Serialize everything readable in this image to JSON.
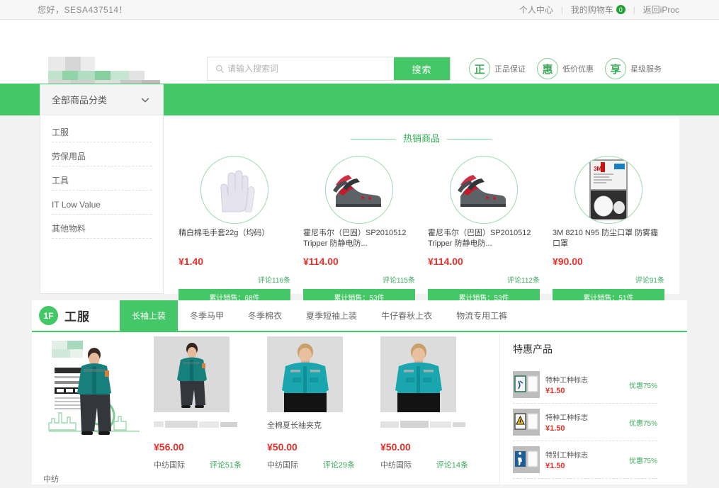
{
  "topbar": {
    "greeting": "您好，SESA437514！",
    "links": [
      {
        "label": "个人中心"
      },
      {
        "label": "我的购物车",
        "badge": "0"
      },
      {
        "label": "返回iProc"
      }
    ],
    "separator": "|"
  },
  "header": {
    "search": {
      "placeholder": "请输入搜索词",
      "value": "",
      "button_label": "搜索",
      "icon": "search-icon"
    },
    "badges": [
      {
        "glyph": "正",
        "label": "正品保证"
      },
      {
        "glyph": "惠",
        "label": "低价优惠"
      },
      {
        "glyph": "享",
        "label": "星级服务"
      }
    ]
  },
  "category_panel": {
    "title": "全部商品分类",
    "chevron_icon": "chevron-down-icon",
    "items": [
      {
        "label": "工服"
      },
      {
        "label": "劳保用品"
      },
      {
        "label": "工具"
      },
      {
        "label": "IT Low Value"
      },
      {
        "label": "其他物料"
      }
    ]
  },
  "hot_section": {
    "title": "热销商品",
    "products": [
      {
        "name": "精白棉毛手套22g（均码）",
        "price": "¥1.40",
        "comments": "评论116条",
        "sales": "累计销售：68件",
        "image": "white-cotton-gloves"
      },
      {
        "name": "霍尼韦尔（巴固）SP2010512 Tripper 防静电防...",
        "price": "¥114.00",
        "comments": "评论115条",
        "sales": "累计销售：53件",
        "image": "safety-shoes"
      },
      {
        "name": "霍尼韦尔（巴固）SP2010512 Tripper 防静电防...",
        "price": "¥114.00",
        "comments": "评论112条",
        "sales": "累计销售：53件",
        "image": "safety-shoes"
      },
      {
        "name": "3M 8210 N95 防尘口罩 防雾霾口罩",
        "price": "¥90.00",
        "comments": "评论91条",
        "sales": "累计销售：51件",
        "image": "n95-mask-box"
      }
    ]
  },
  "floor": {
    "badge": "1F",
    "title": "工服",
    "tabs": [
      {
        "label": "长袖上装",
        "active": true
      },
      {
        "label": "冬季马甲",
        "active": false
      },
      {
        "label": "冬季棉衣",
        "active": false
      },
      {
        "label": "夏季短袖上装",
        "active": false
      },
      {
        "label": "牛仔春秋上衣",
        "active": false
      },
      {
        "label": "物流专用工裤",
        "active": false
      }
    ],
    "banner": {
      "headline": "时尚精品工装",
      "sub": "FASHION BOUTIQUE TOOLING",
      "caption": "中纺"
    },
    "products": [
      {
        "name": "",
        "name_redacted": true,
        "price": "¥56.00",
        "brand": "中纺国际",
        "comments": "评论51条",
        "image": "worker-full-body-teal-uniform"
      },
      {
        "name": "全棉夏长袖夹克",
        "name_redacted": false,
        "price": "¥50.00",
        "brand": "中纺国际",
        "comments": "评论29条",
        "image": "teal-jacket-model"
      },
      {
        "name": "",
        "name_redacted": true,
        "price": "¥50.00",
        "brand": "中纺国际",
        "comments": "评论14条",
        "image": "teal-jacket-model"
      }
    ]
  },
  "promo": {
    "title": "特惠产品",
    "items": [
      {
        "name": "特种工种标志",
        "price": "¥1.50",
        "discount": "优惠75%",
        "image": "sign-plate-worker"
      },
      {
        "name": "特种工种标志",
        "price": "¥1.50",
        "discount": "优惠75%",
        "image": "sign-plate-warning"
      },
      {
        "name": "特别工种标志",
        "price": "¥1.50",
        "discount": "优惠75%",
        "image": "sign-plate-blue"
      }
    ]
  },
  "colors": {
    "brand_green": "#44c767",
    "price_red": "#e4322b",
    "accent_green_text": "#3faa5e",
    "badge_dark_green": "#23a038"
  }
}
